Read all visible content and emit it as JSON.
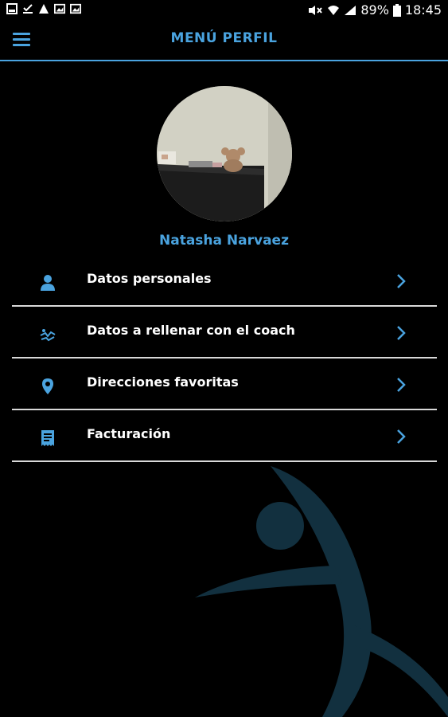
{
  "status_bar": {
    "battery": "89%",
    "time": "18:45"
  },
  "header": {
    "title": "MENÚ PERFIL",
    "menu_icon": "hamburger-menu-icon",
    "accent_color": "#4aa3df"
  },
  "profile": {
    "name": "Natasha Narvaez"
  },
  "menu": {
    "items": [
      {
        "label": "Datos personales",
        "icon": "person-icon"
      },
      {
        "label": "Datos a rellenar con el coach",
        "icon": "coach-icon"
      },
      {
        "label": "Direcciones favoritas",
        "icon": "location-pin-icon"
      },
      {
        "label": "Facturación",
        "icon": "receipt-icon"
      }
    ],
    "chevron_icon": "chevron-right-icon"
  }
}
